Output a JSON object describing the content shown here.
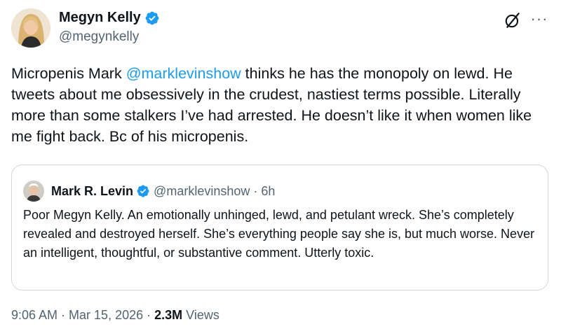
{
  "author": {
    "display_name": "Megyn Kelly",
    "handle": "@megynkelly"
  },
  "tweet": {
    "text_before": "Micropenis Mark ",
    "mention": "@marklevinshow",
    "text_after": " thinks he has the monopoly on lewd. He tweets about me obsessively in the crudest, nastiest terms possible. Literally more than some stalkers I’ve had arrested. He doesn’t like it when women like me fight back. Bc of his micropenis."
  },
  "quoted_tweet": {
    "display_name": "Mark R. Levin",
    "handle_time": "@marklevinshow · 6h",
    "text": "Poor Megyn Kelly.  An emotionally unhinged, lewd, and petulant wreck.  She’s completely revealed and destroyed herself. She’s everything people say she is, but much worse.  Never an intelligent, thoughtful, or substantive comment.  Utterly toxic."
  },
  "meta": {
    "time": "9:06 AM",
    "sep1": " · ",
    "date": "Mar 15, 2026",
    "sep2": " · ",
    "views_count": "2.3M",
    "views_label": " Views"
  },
  "colors": {
    "accent": "#1d9bf0",
    "text": "#0f1419",
    "secondary": "#536471",
    "border": "#cfd9de"
  },
  "icons": {
    "verified": "verified-badge-icon",
    "grok": "grok-icon",
    "more": "more-options-icon"
  }
}
